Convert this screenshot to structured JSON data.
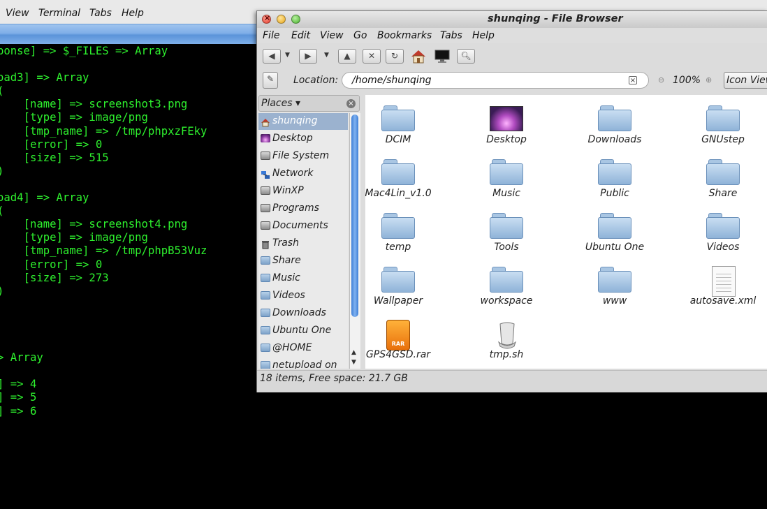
{
  "terminal": {
    "menus": [
      "View",
      "Terminal",
      "Tabs",
      "Help"
    ],
    "output_lines": [
      "ponse] => $_FILES => Array",
      "",
      "oad3] => Array",
      "(",
      "    [name] => screenshot3.png",
      "    [type] => image/png",
      "    [tmp_name] => /tmp/phpxzFEky",
      "    [error] => 0",
      "    [size] => 515",
      ")",
      "",
      "oad4] => Array",
      "(",
      "    [name] => screenshot4.png",
      "    [type] => image/png",
      "    [tmp_name] => /tmp/phpB53Vuz",
      "    [error] => 0",
      "    [size] => 273",
      ")",
      "",
      "",
      "",
      "",
      "> Array",
      "",
      "] => 4",
      "] => 5",
      "] => 6"
    ],
    "text_color": "#2ef12e"
  },
  "file_browser": {
    "title": "shunqing - File Browser",
    "menus": [
      "File",
      "Edit",
      "View",
      "Go",
      "Bookmarks",
      "Tabs",
      "Help"
    ],
    "location_label": "Location:",
    "location_value": "/home/shunqing",
    "zoom": "100%",
    "view_mode": "Icon View",
    "places_label": "Places ▾",
    "places": [
      {
        "label": "shunqing",
        "icon": "home-icon",
        "selected": true
      },
      {
        "label": "Desktop",
        "icon": "desktop-icon"
      },
      {
        "label": "File System",
        "icon": "drive-icon"
      },
      {
        "label": "Network",
        "icon": "network-icon"
      },
      {
        "label": "WinXP",
        "icon": "drive-icon"
      },
      {
        "label": "Programs",
        "icon": "drive-icon"
      },
      {
        "label": "Documents",
        "icon": "drive-icon"
      },
      {
        "label": "Trash",
        "icon": "trash-icon"
      },
      {
        "label": "Share",
        "icon": "folder-icon"
      },
      {
        "label": "Music",
        "icon": "folder-icon"
      },
      {
        "label": "Videos",
        "icon": "folder-icon"
      },
      {
        "label": "Downloads",
        "icon": "folder-icon"
      },
      {
        "label": "Ubuntu One",
        "icon": "folder-icon"
      },
      {
        "label": "@HOME",
        "icon": "folder-icon"
      },
      {
        "label": "netupload on",
        "icon": "folder-icon"
      }
    ],
    "items": [
      {
        "label": "DCIM",
        "kind": "folder"
      },
      {
        "label": "Desktop",
        "kind": "desktop"
      },
      {
        "label": "Downloads",
        "kind": "folder"
      },
      {
        "label": "GNUstep",
        "kind": "folder"
      },
      {
        "label": "Mac4Lin_v1.0",
        "kind": "folder"
      },
      {
        "label": "Music",
        "kind": "folder"
      },
      {
        "label": "Public",
        "kind": "folder"
      },
      {
        "label": "Share",
        "kind": "folder"
      },
      {
        "label": "temp",
        "kind": "folder"
      },
      {
        "label": "Tools",
        "kind": "folder"
      },
      {
        "label": "Ubuntu One",
        "kind": "folder"
      },
      {
        "label": "Videos",
        "kind": "folder"
      },
      {
        "label": "Wallpaper",
        "kind": "folder"
      },
      {
        "label": "workspace",
        "kind": "folder"
      },
      {
        "label": "www",
        "kind": "folder"
      },
      {
        "label": "autosave.xml",
        "kind": "document"
      },
      {
        "label": "GPS4GSD.rar",
        "kind": "archive"
      },
      {
        "label": "tmp.sh",
        "kind": "script"
      }
    ],
    "status": "18 items, Free space: 21.7 GB",
    "selection_color": "#9bb2cf"
  }
}
